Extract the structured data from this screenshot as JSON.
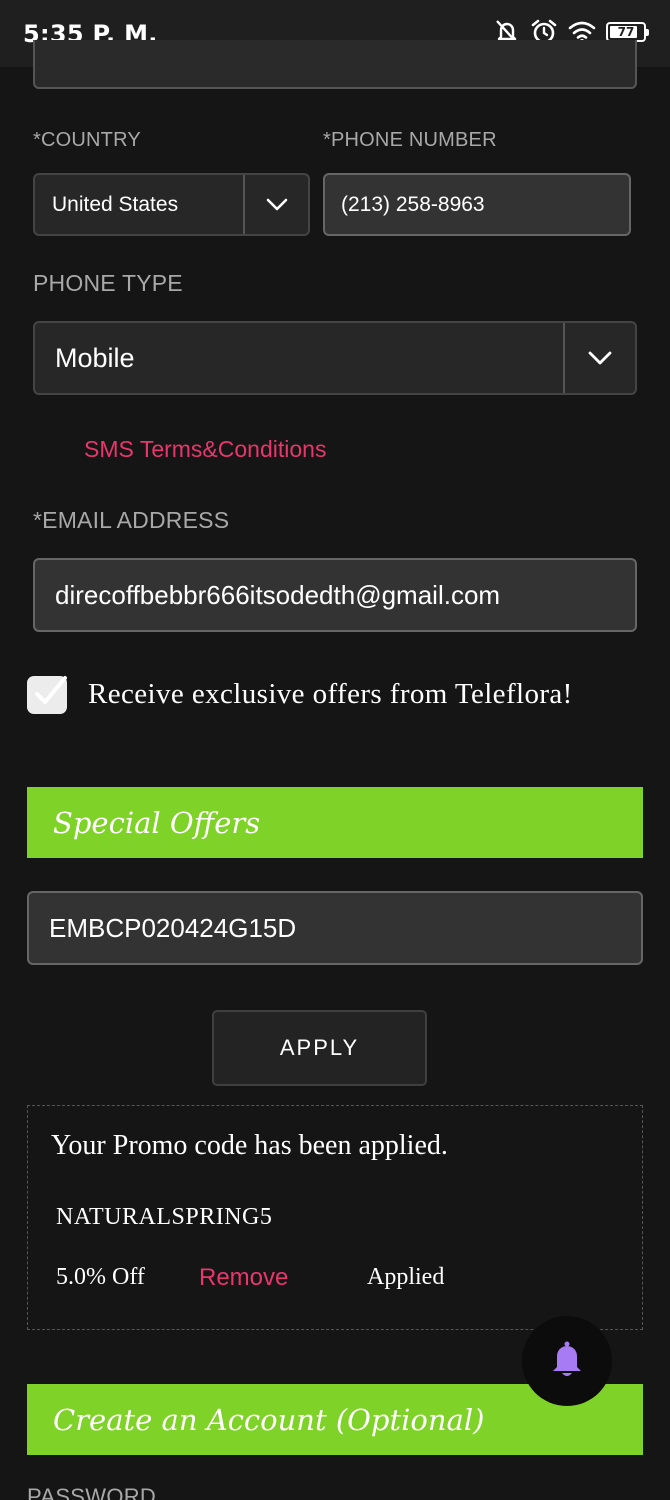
{
  "status_bar": {
    "time": "5:35 P. M.",
    "battery_level": "77",
    "icons": [
      "notifications-off-icon",
      "alarm-icon",
      "wifi-icon",
      "battery-icon"
    ]
  },
  "form": {
    "country": {
      "label": "*COUNTRY",
      "value": "United States"
    },
    "phone_number": {
      "label": "*PHONE NUMBER",
      "value": "(213) 258-8963"
    },
    "phone_type": {
      "label": "PHONE TYPE",
      "value": "Mobile"
    },
    "sms_terms_link": "SMS Terms&Conditions",
    "email": {
      "label": "*EMAIL ADDRESS",
      "value": "direcoffbebbr666itsodedth@gmail.com"
    },
    "offers_checkbox": {
      "label": "Receive exclusive offers from Teleflora!",
      "checked": true
    },
    "password_label": "PASSWORD"
  },
  "special_offers": {
    "title": "Special Offers",
    "promo_input_value": "EMBCP020424G15D",
    "apply_label": "APPLY",
    "applied": {
      "message": "Your Promo code has been applied.",
      "code": "NATURALSPRING5",
      "discount": "5.0% Off",
      "remove_label": "Remove",
      "status": "Applied"
    }
  },
  "create_account": {
    "title": "Create an Account (Optional)"
  },
  "colors": {
    "background": "#151515",
    "accent_green": "#7fd228",
    "link_pink": "#e8366d",
    "bell_purple": "#a77bf3"
  }
}
